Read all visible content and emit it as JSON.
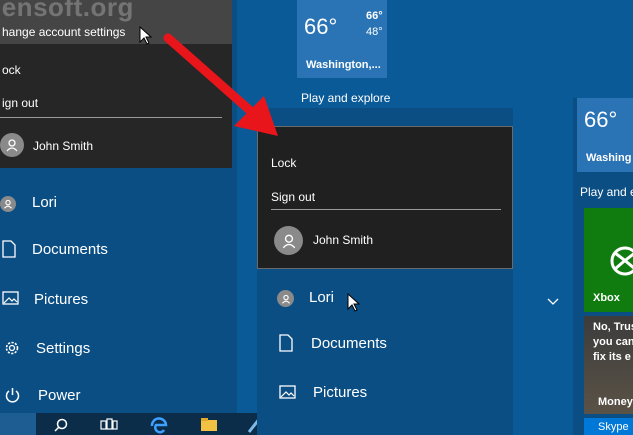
{
  "watermark": "jensoft.org",
  "left": {
    "popup": {
      "change_settings": "hange account settings",
      "lock": "ock",
      "sign_out": "ign out",
      "user": "John Smith"
    },
    "nav": [
      "Lori",
      "Documents",
      "Pictures",
      "Settings",
      "Power"
    ]
  },
  "weather_tile": {
    "temp": "66°",
    "high": "66°",
    "low": "48°",
    "city": "Washington,..."
  },
  "group_label": "Play and explore",
  "middle": {
    "popup": {
      "lock": "Lock",
      "sign_out": "Sign out",
      "user": "John Smith"
    },
    "nav": [
      "Lori",
      "Documents",
      "Pictures"
    ]
  },
  "right": {
    "temp": "66°",
    "city": "Washing",
    "group_label": "Play and e",
    "xbox": "Xbox",
    "news": "No, Trus\nyou can\nfix its e",
    "money": "Money",
    "skype": "Skype"
  },
  "colors": {
    "accent_arrow": "#e8151b",
    "xbox_green": "#107c10",
    "tile_blue": "#2a73b4"
  }
}
